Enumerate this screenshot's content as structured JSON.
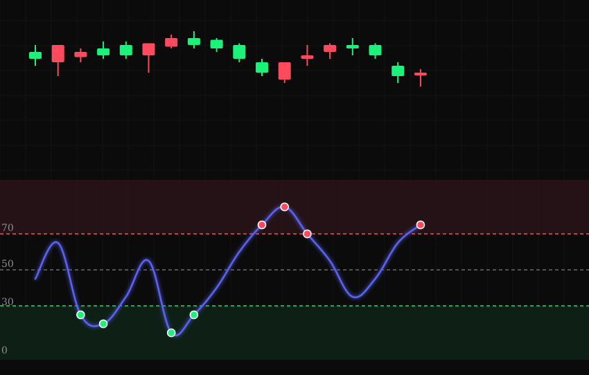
{
  "colors": {
    "background": "#0b0b0c",
    "grid": "#1a1a1d",
    "bull": "#1af27a",
    "bear": "#ff4a5e",
    "rsi_line": "#5a62f0",
    "overbought_zone": "#2a1419",
    "oversold_zone": "#0f2418",
    "overbought_line": "#ff4a5e",
    "midline": "#6b6b72",
    "oversold_line": "#1fd97a",
    "tick_text": "#8f8f96"
  },
  "chart_data": [
    {
      "type": "candlestick",
      "title": "",
      "xlabel": "",
      "ylabel": "",
      "ylim": [
        60,
        102
      ],
      "grid": true,
      "candles": [
        {
          "open": 91,
          "close": 93,
          "high": 95,
          "low": 89
        },
        {
          "open": 95,
          "close": 90,
          "high": 95,
          "low": 86
        },
        {
          "open": 93,
          "close": 91.5,
          "high": 94,
          "low": 90
        },
        {
          "open": 92,
          "close": 94,
          "high": 96,
          "low": 91
        },
        {
          "open": 92,
          "close": 95,
          "high": 96,
          "low": 91
        },
        {
          "open": 95.5,
          "close": 92,
          "high": 95.5,
          "low": 87
        },
        {
          "open": 97,
          "close": 94.5,
          "high": 98,
          "low": 94
        },
        {
          "open": 95,
          "close": 97,
          "high": 99,
          "low": 94
        },
        {
          "open": 94,
          "close": 96.5,
          "high": 97,
          "low": 93
        },
        {
          "open": 91,
          "close": 95,
          "high": 95.5,
          "low": 90
        },
        {
          "open": 87,
          "close": 90,
          "high": 91,
          "low": 86
        },
        {
          "open": 90,
          "close": 85,
          "high": 90,
          "low": 84
        },
        {
          "open": 92,
          "close": 91,
          "high": 95,
          "low": 89
        },
        {
          "open": 95,
          "close": 93,
          "high": 95.5,
          "low": 91
        },
        {
          "open": 94,
          "close": 95,
          "high": 97,
          "low": 92
        },
        {
          "open": 92,
          "close": 95,
          "high": 95.5,
          "low": 91
        },
        {
          "open": 86,
          "close": 89,
          "high": 90,
          "low": 84
        },
        {
          "open": 87,
          "close": 86.5,
          "high": 88,
          "low": 83
        }
      ]
    },
    {
      "type": "line",
      "title": "",
      "xlabel": "",
      "ylabel": "",
      "ylim": [
        0,
        100
      ],
      "y_ticks": [
        "70",
        "50",
        "30",
        "0"
      ],
      "zones": [
        {
          "from": 70,
          "to": 100,
          "kind": "overbought"
        },
        {
          "from": 0,
          "to": 30,
          "kind": "oversold"
        }
      ],
      "reference_lines": [
        {
          "value": 70,
          "style": "dashed",
          "color_key": "overbought_line"
        },
        {
          "value": 50,
          "style": "dashed",
          "color_key": "midline"
        },
        {
          "value": 30,
          "style": "dashed",
          "color_key": "oversold_line"
        }
      ],
      "x": [
        0,
        1,
        2,
        3,
        4,
        5,
        6,
        7,
        8,
        9,
        10,
        11,
        12,
        13,
        14,
        15,
        16,
        17
      ],
      "values": [
        45,
        65,
        25,
        20,
        35,
        55,
        15,
        25,
        40,
        60,
        75,
        85,
        70,
        55,
        35,
        45,
        65,
        75
      ],
      "signals": [
        {
          "index": 2,
          "kind": "oversold"
        },
        {
          "index": 3,
          "kind": "oversold"
        },
        {
          "index": 6,
          "kind": "oversold"
        },
        {
          "index": 7,
          "kind": "oversold"
        },
        {
          "index": 10,
          "kind": "overbought"
        },
        {
          "index": 11,
          "kind": "overbought"
        },
        {
          "index": 12,
          "kind": "overbought"
        },
        {
          "index": 17,
          "kind": "overbought"
        }
      ]
    }
  ]
}
